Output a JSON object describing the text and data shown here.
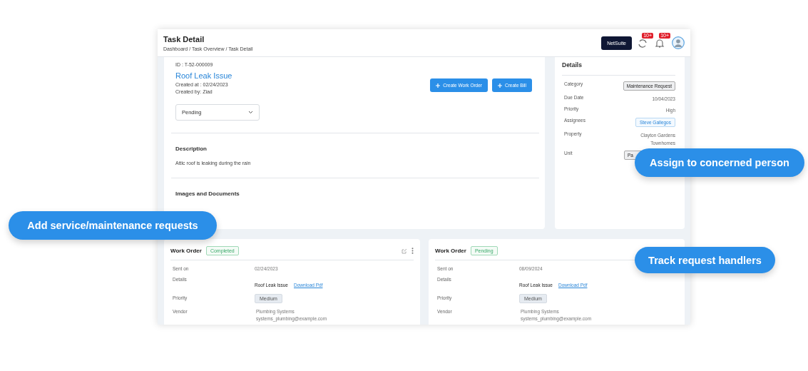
{
  "header": {
    "title": "Task Detail",
    "breadcrumb": "Dashboard / Task Overview / Task Detail",
    "app_button": "NetSuite",
    "badges": [
      "10+",
      "10+"
    ]
  },
  "task": {
    "id": "ID : T-52-000009",
    "title": "Roof Leak Issue",
    "created_at": "Created at : 02/24/2023",
    "created_by": "Created by: Ziad",
    "status": "Pending",
    "actions": [
      "Create Work Order",
      "Create Bill"
    ],
    "description_heading": "Description",
    "description": "Attic roof is leaking during the rain",
    "documents_heading": "Images and Documents"
  },
  "details": {
    "title": "Details",
    "rows": [
      {
        "label": "Category",
        "kind": "tag",
        "value": "Maintenance Request"
      },
      {
        "label": "Due Date",
        "kind": "text",
        "value": "10/04/2023"
      },
      {
        "label": "Priority",
        "kind": "text",
        "value": "High"
      },
      {
        "label": "Assignees",
        "kind": "person",
        "value": "Steve Gallegos"
      },
      {
        "label": "Property",
        "kind": "text",
        "value": "Clayton Gardens Townhomes"
      },
      {
        "label": "Unit",
        "kind": "tag",
        "value": "Pa"
      }
    ]
  },
  "work_orders": [
    {
      "title": "Work Order",
      "status": "Completed",
      "show_actions": true,
      "sent_label": "Sent on",
      "sent": "02/24/2023",
      "details_label": "Details",
      "details": "Roof Leak Issue",
      "link": "Download Pdf",
      "priority_label": "Priority",
      "priority": "Medium",
      "vendor_label": "Vendor",
      "vendor": "Plumbing Systems",
      "vendor_email": "systems_plumbing@example.com"
    },
    {
      "title": "Work Order",
      "status": "Pending",
      "sent_label": "Sent on",
      "sent": "08/09/2024",
      "details_label": "Details",
      "details": "Roof Leak Issue",
      "link": "Download Pdf",
      "priority_label": "Priority",
      "priority": "Medium",
      "vendor_label": "Vendor",
      "vendor": "Plumbing Systems",
      "vendor_email": "systems_plumbing@example.com"
    }
  ],
  "callouts": [
    {
      "text": "Add service/maintenance requests"
    },
    {
      "text": "Assign to concerned person"
    },
    {
      "text": "Track request handlers"
    }
  ]
}
